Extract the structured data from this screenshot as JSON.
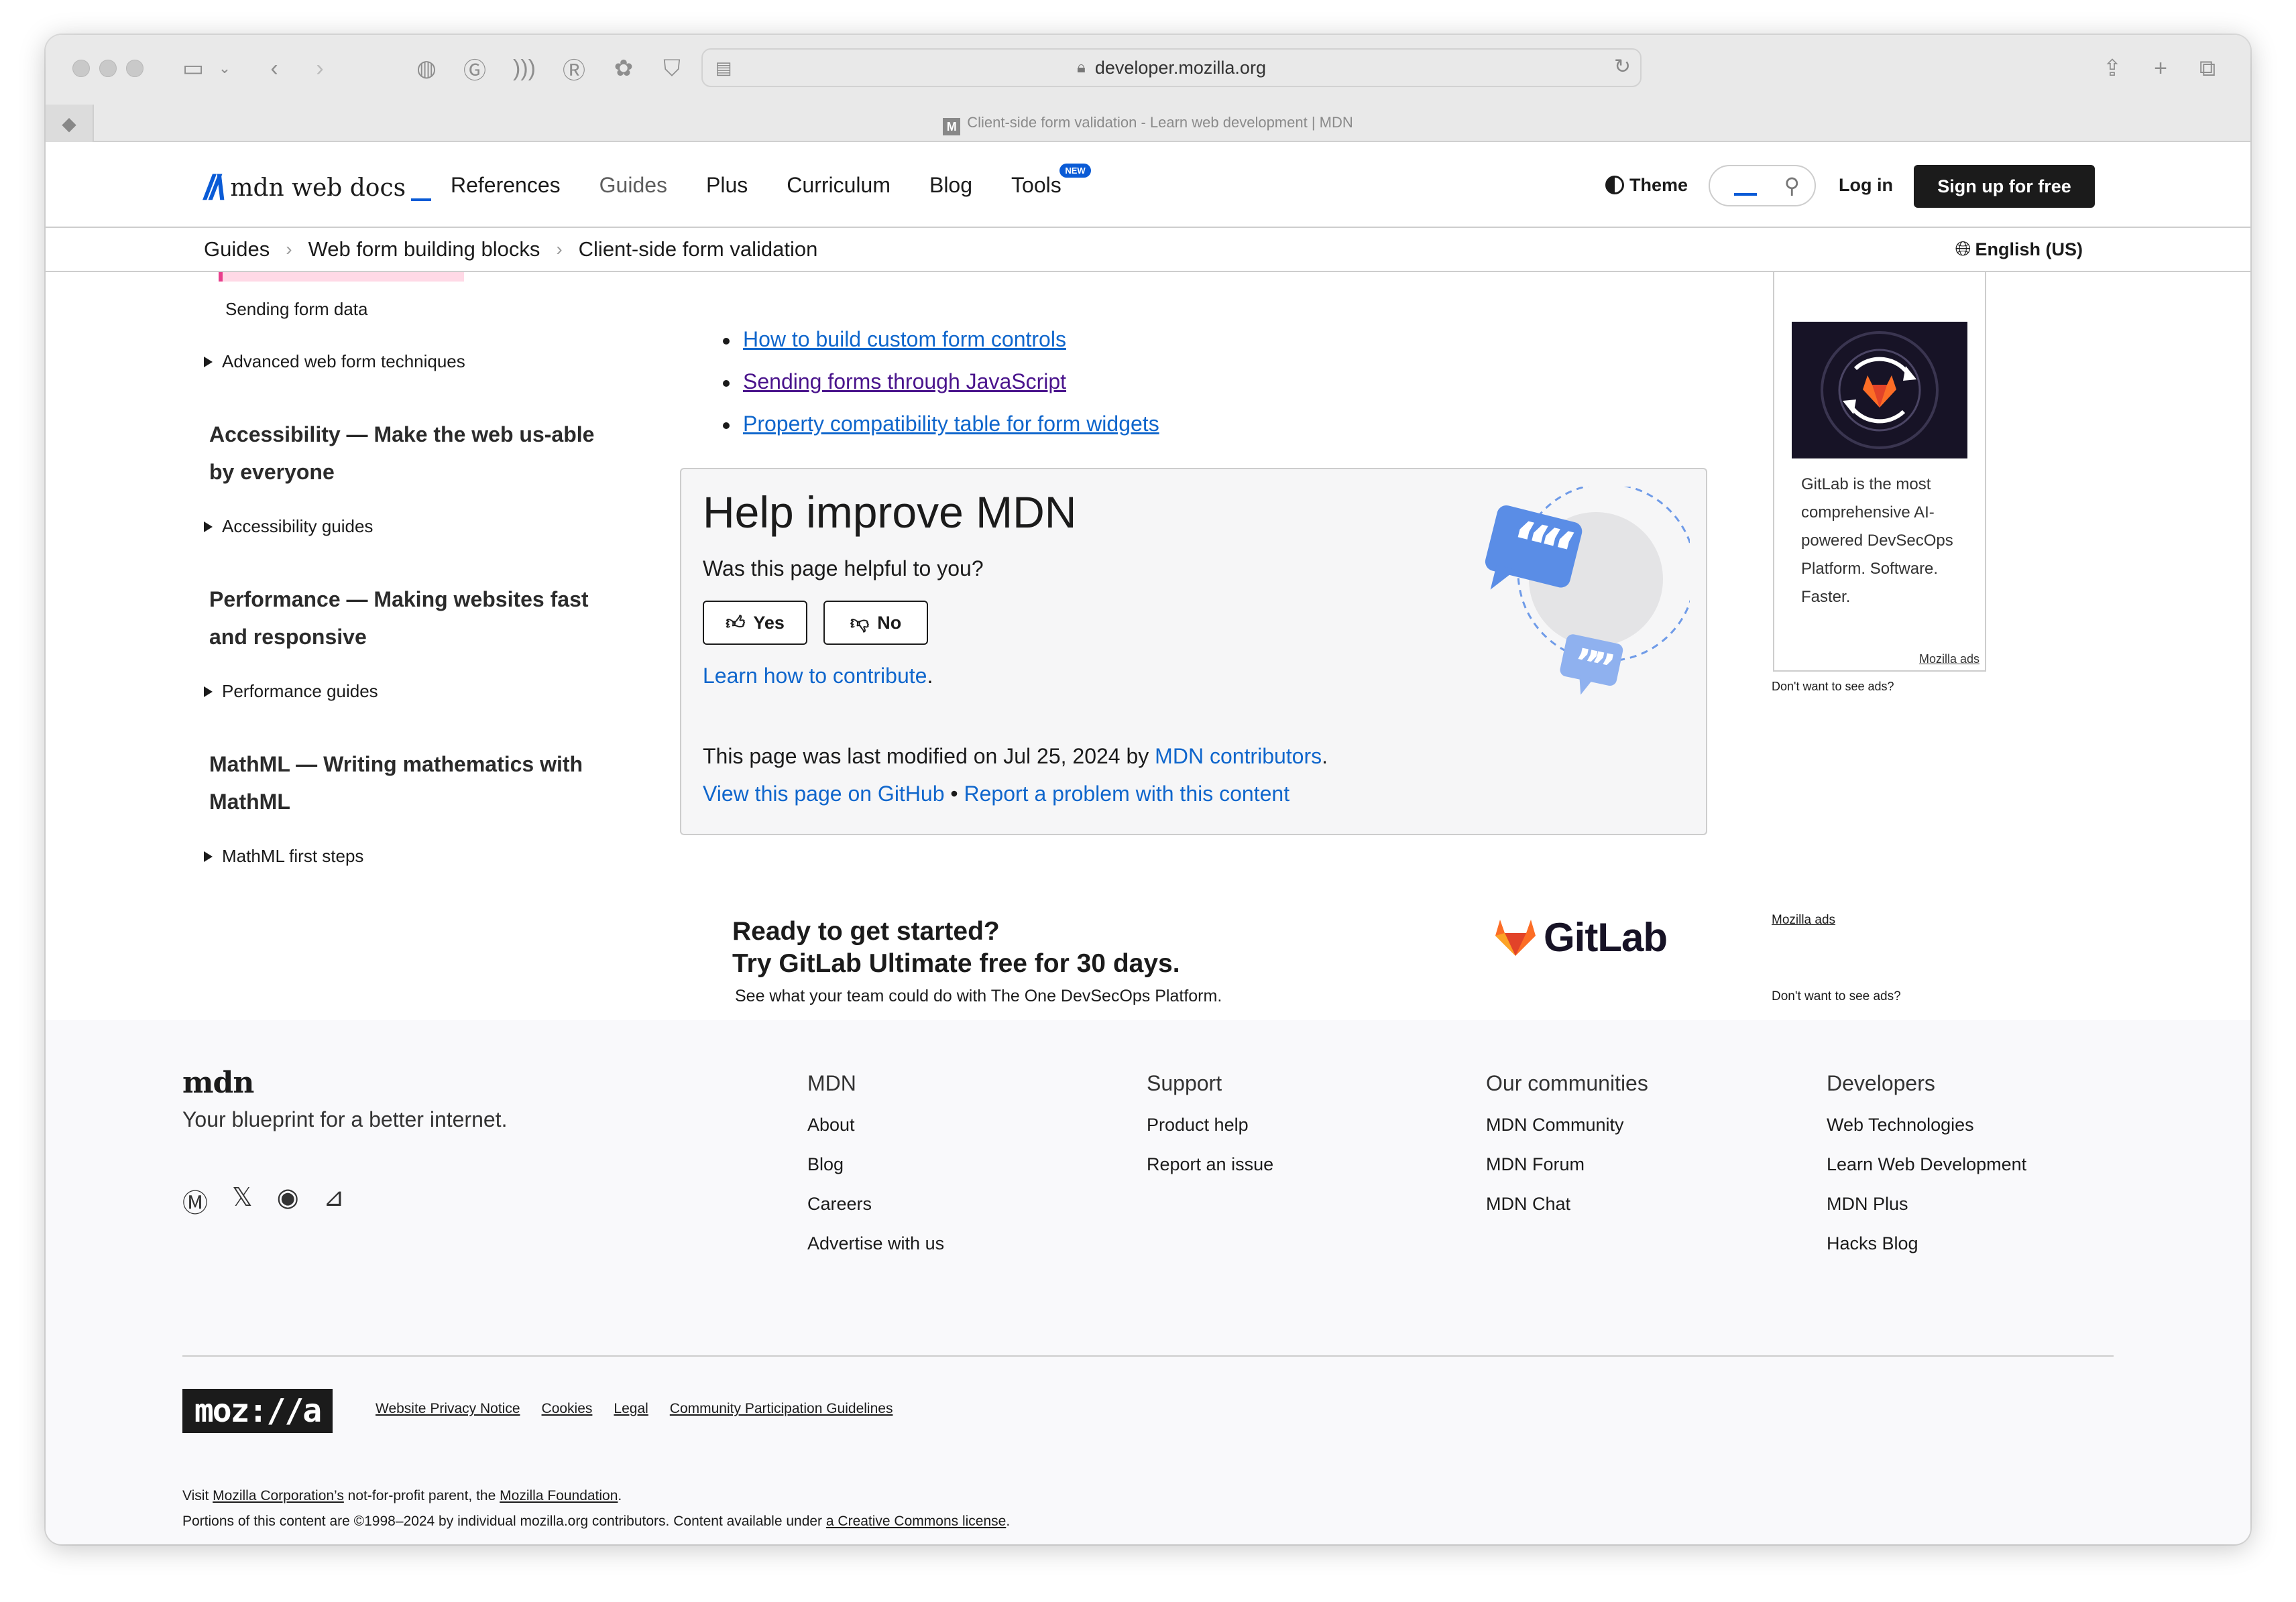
{
  "browser": {
    "url": "developer.mozilla.org",
    "tab_title": "Client-side form validation - Learn web development | MDN",
    "favicon_letter": "M"
  },
  "header": {
    "logo_text": "mdn web docs",
    "nav": [
      "References",
      "Guides",
      "Plus",
      "Curriculum",
      "Blog",
      "Tools"
    ],
    "tools_badge": "NEW",
    "theme": "Theme",
    "login": "Log in",
    "signup": "Sign up for free"
  },
  "breadcrumb": {
    "items": [
      "Guides",
      "Web form building blocks",
      "Client-side form validation"
    ],
    "language": "English (US)"
  },
  "sidebar": {
    "items": [
      "Sending form data",
      "Advanced web form techniques",
      "Accessibility — Make the web us-able by everyone",
      "Accessibility guides",
      "Performance — Making websites fast and responsive",
      "Performance guides",
      "MathML — Writing mathematics with MathML",
      "MathML first steps"
    ]
  },
  "main": {
    "links": [
      "How to build custom form controls",
      "Sending forms through JavaScript",
      "Property compatibility table for form widgets"
    ]
  },
  "help": {
    "title": "Help improve MDN",
    "question": "Was this page helpful to you?",
    "yes": "Yes",
    "no": "No",
    "learn_link": "Learn how to contribute",
    "learn_after": ".",
    "lastmod_prefix": "This page was last modified on Jul 25, 2024 by ",
    "lastmod_link": "MDN contributors",
    "lastmod_suffix": ".",
    "github_link": "View this page on GitHub",
    "dot": " • ",
    "report_link": "Report a problem with this content"
  },
  "ad_side": {
    "text": "GitLab is the most comprehensive AI-powered DevSecOps Platform. Software. Faster.",
    "footer": "Mozilla ads",
    "no_ads": "Don't want to see ads?"
  },
  "ad_banner": {
    "line1": "Ready to get started?",
    "line2": "Try GitLab Ultimate free for 30 days.",
    "line3": "See what your team could do with The One DevSecOps Platform.",
    "brand": "GitLab",
    "mozilla_ads": "Mozilla ads",
    "no_ads": "Don't want to see ads?"
  },
  "footer": {
    "logo": "mdn",
    "tagline": "Your blueprint for a better internet.",
    "columns": [
      {
        "title": "MDN",
        "links": [
          "About",
          "Blog",
          "Careers",
          "Advertise with us"
        ]
      },
      {
        "title": "Support",
        "links": [
          "Product help",
          "Report an issue"
        ]
      },
      {
        "title": "Our communities",
        "links": [
          "MDN Community",
          "MDN Forum",
          "MDN Chat"
        ]
      },
      {
        "title": "Developers",
        "links": [
          "Web Technologies",
          "Learn Web Development",
          "MDN Plus",
          "Hacks Blog"
        ]
      }
    ],
    "mozilla_logo": "moz://a",
    "legal": [
      "Website Privacy Notice",
      "Cookies",
      "Legal",
      "Community Participation Guidelines"
    ],
    "visit_1": "Visit ",
    "visit_link1": "Mozilla Corporation’s",
    "visit_2": " not-for-profit parent, the ",
    "visit_link2": "Mozilla Foundation",
    "visit_3": ".",
    "portions_1": "Portions of this content are ©1998–2024 by individual mozilla.org contributors. Content available under ",
    "portions_link": "a Creative Commons license",
    "portions_2": "."
  }
}
